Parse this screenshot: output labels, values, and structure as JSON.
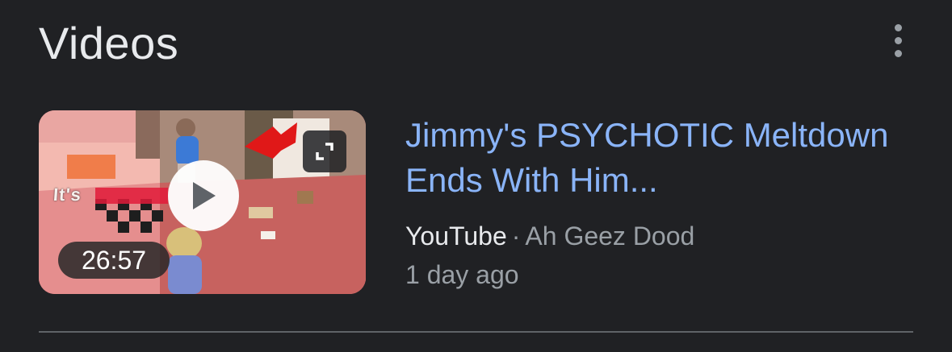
{
  "section": {
    "title": "Videos",
    "more_icon": "more-vert-icon"
  },
  "video": {
    "title": "Jimmy's PSYCHOTIC Meltdown Ends With Him...",
    "duration": "26:57",
    "thumbnail_overlay_text": "It's",
    "source": "YouTube",
    "separator": "·",
    "channel": "Ah Geez Dood",
    "date": "1 day ago",
    "play_icon": "play-icon",
    "expand_icon": "expand-icon"
  },
  "colors": {
    "background": "#202124",
    "title_link": "#8ab4f8",
    "primary_text": "#e8eaed",
    "secondary_text": "#9aa0a6",
    "divider": "#5f6368"
  }
}
